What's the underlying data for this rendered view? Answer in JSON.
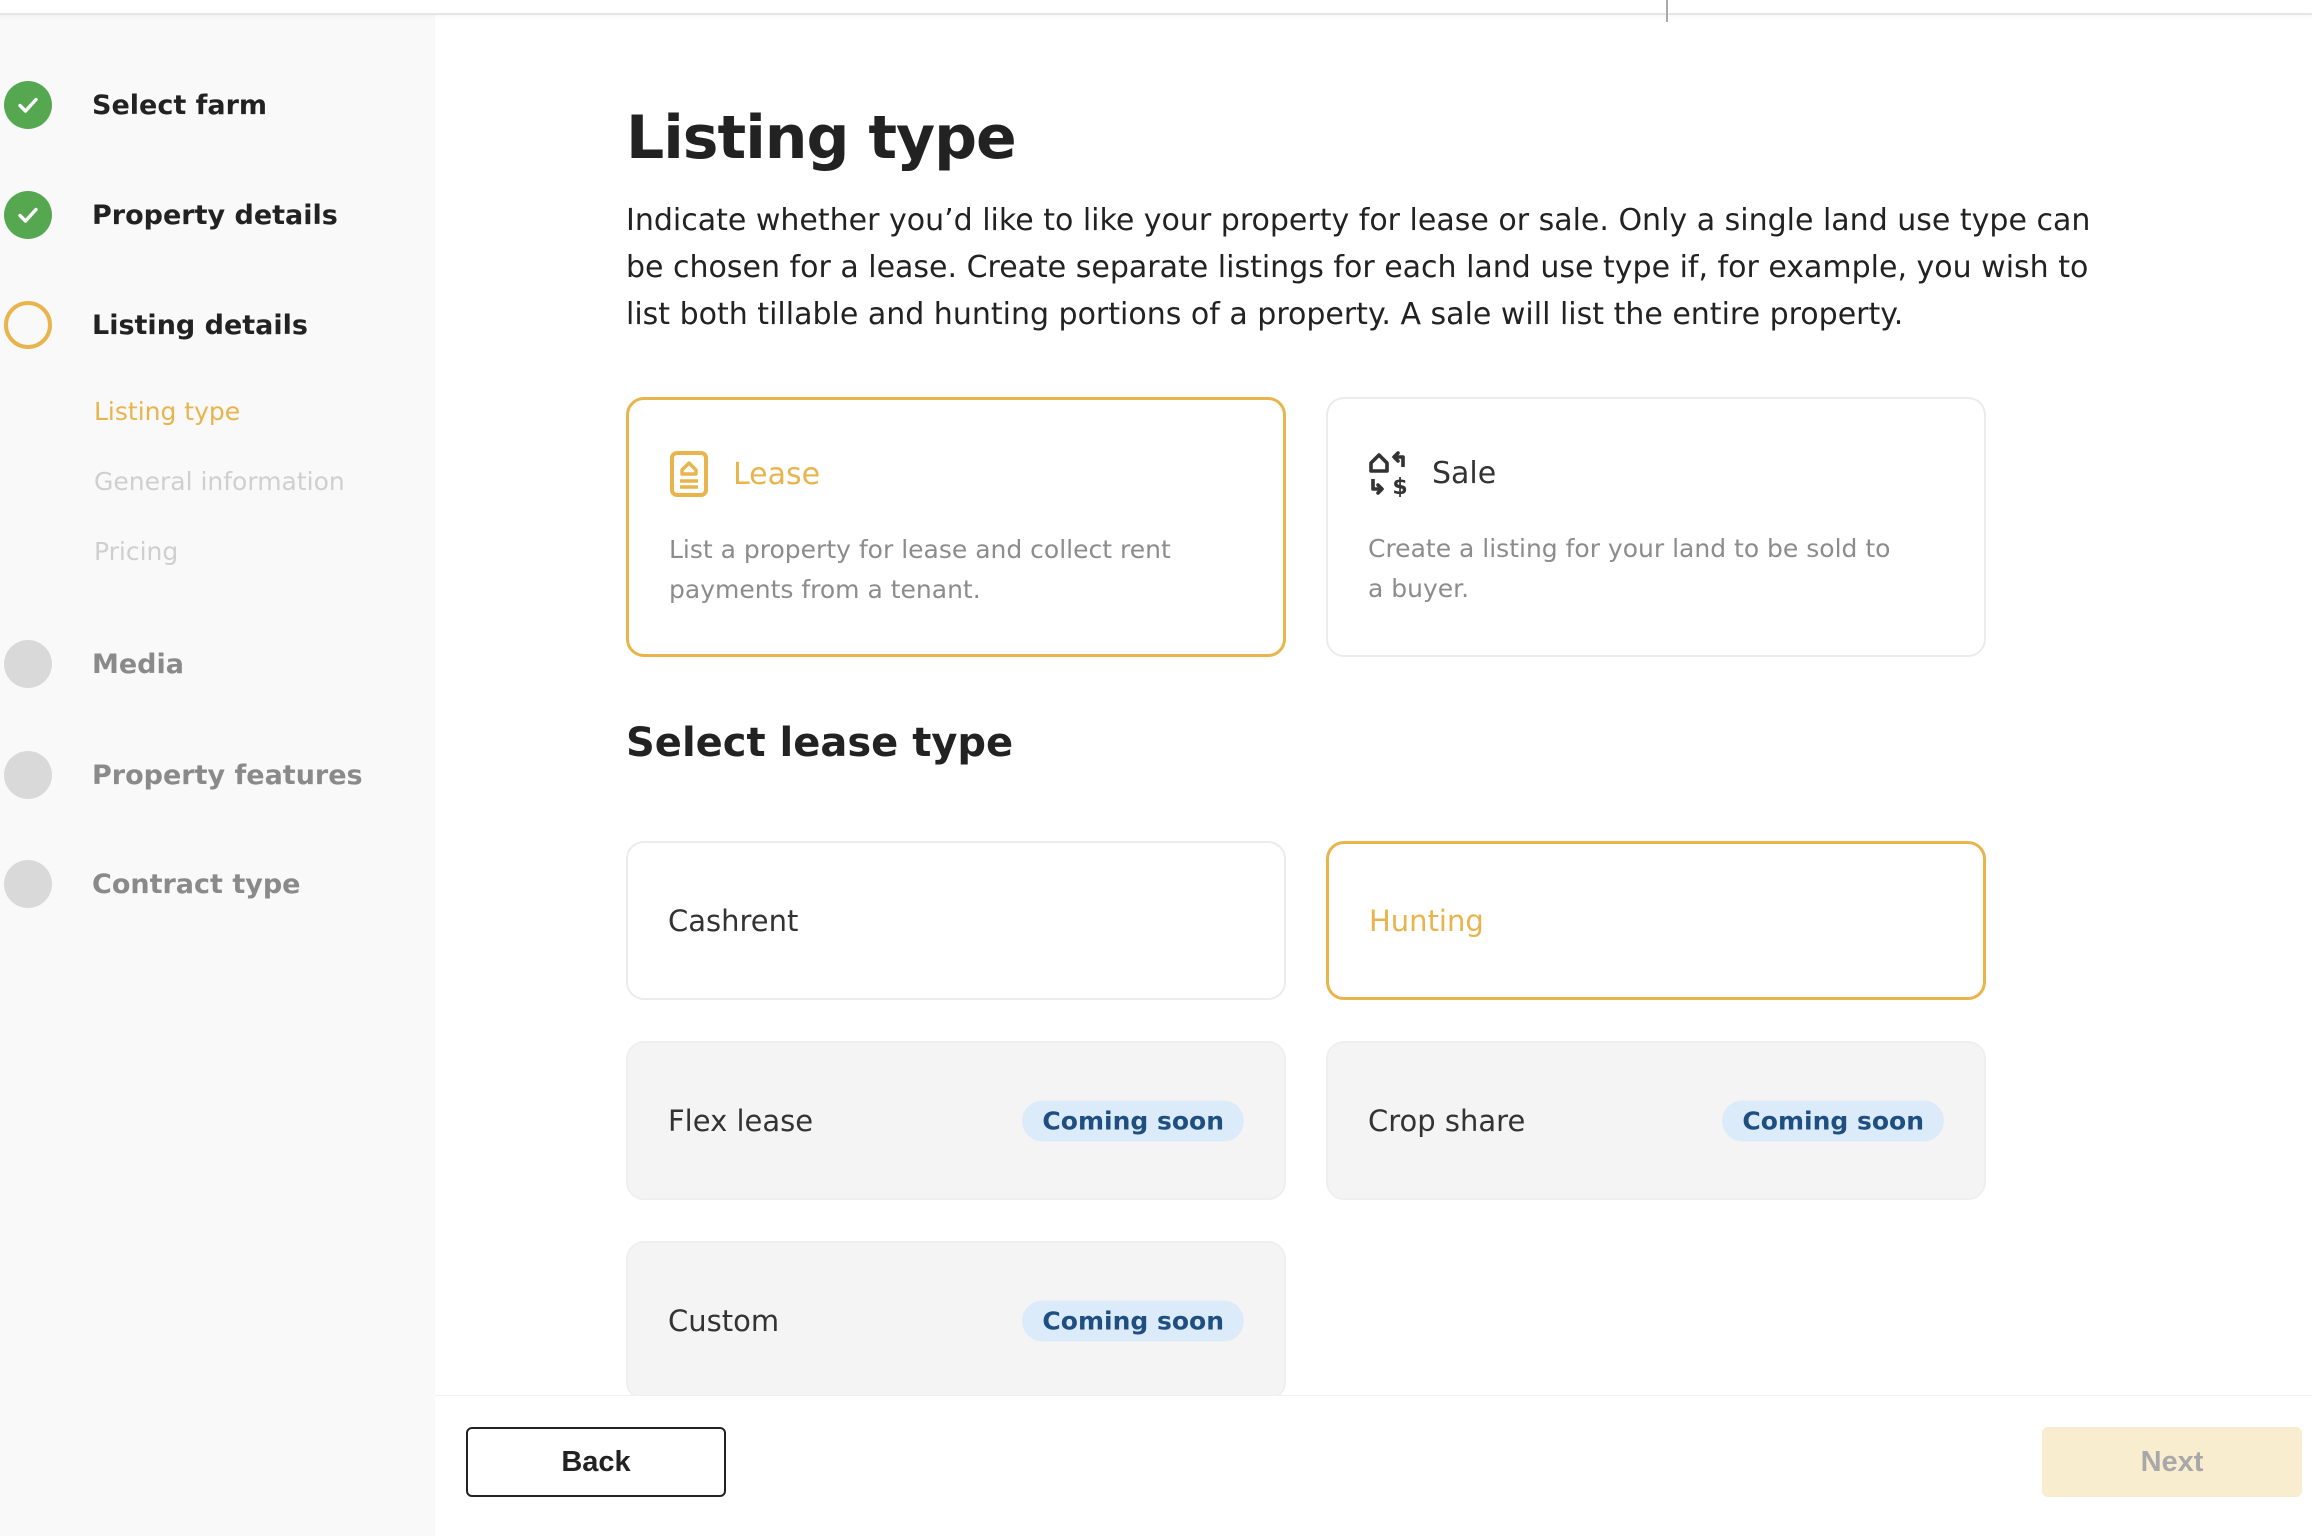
{
  "colors": {
    "accent": "#e9b44c",
    "done": "#55a850",
    "todo": "#d9d9d9",
    "badge_bg": "#dcebf9",
    "badge_text": "#1f4f80",
    "next_disabled_bg": "#f8edcf"
  },
  "sidebar": {
    "steps": [
      {
        "label": "Select farm",
        "status": "done",
        "icon": "check-icon"
      },
      {
        "label": "Property details",
        "status": "done",
        "icon": "check-icon"
      },
      {
        "label": "Listing details",
        "status": "active",
        "icon": "ring-icon",
        "substeps": [
          {
            "label": "Listing type",
            "status": "active"
          },
          {
            "label": "General information",
            "status": "todo"
          },
          {
            "label": "Pricing",
            "status": "todo"
          }
        ]
      },
      {
        "label": "Media",
        "status": "todo"
      },
      {
        "label": "Property features",
        "status": "todo"
      },
      {
        "label": "Contract type",
        "status": "todo"
      }
    ]
  },
  "main": {
    "title": "Listing type",
    "description": "Indicate whether you’d like to like your property for lease or sale. Only a single land use type can be chosen for a lease. Create separate listings for each land use type if, for example, you wish to list both tillable and hunting portions of a property. A sale will list the entire property.",
    "listing_options": [
      {
        "title": "Lease",
        "description": "List a property for lease and collect rent payments from a tenant.",
        "icon": "lease-document-icon",
        "selected": true
      },
      {
        "title": "Sale",
        "description": "Create a listing for your land to be sold to a buyer.",
        "icon": "house-dollar-exchange-icon",
        "selected": false
      }
    ],
    "lease_section_title": "Select lease type",
    "lease_types": [
      {
        "label": "Cashrent",
        "selected": false,
        "disabled": false,
        "badge": null
      },
      {
        "label": "Hunting",
        "selected": true,
        "disabled": false,
        "badge": null
      },
      {
        "label": "Flex lease",
        "selected": false,
        "disabled": true,
        "badge": "Coming soon"
      },
      {
        "label": "Crop share",
        "selected": false,
        "disabled": true,
        "badge": "Coming soon"
      },
      {
        "label": "Custom",
        "selected": false,
        "disabled": true,
        "badge": "Coming soon"
      }
    ]
  },
  "footer": {
    "back_label": "Back",
    "next_label": "Next",
    "next_disabled": true
  }
}
